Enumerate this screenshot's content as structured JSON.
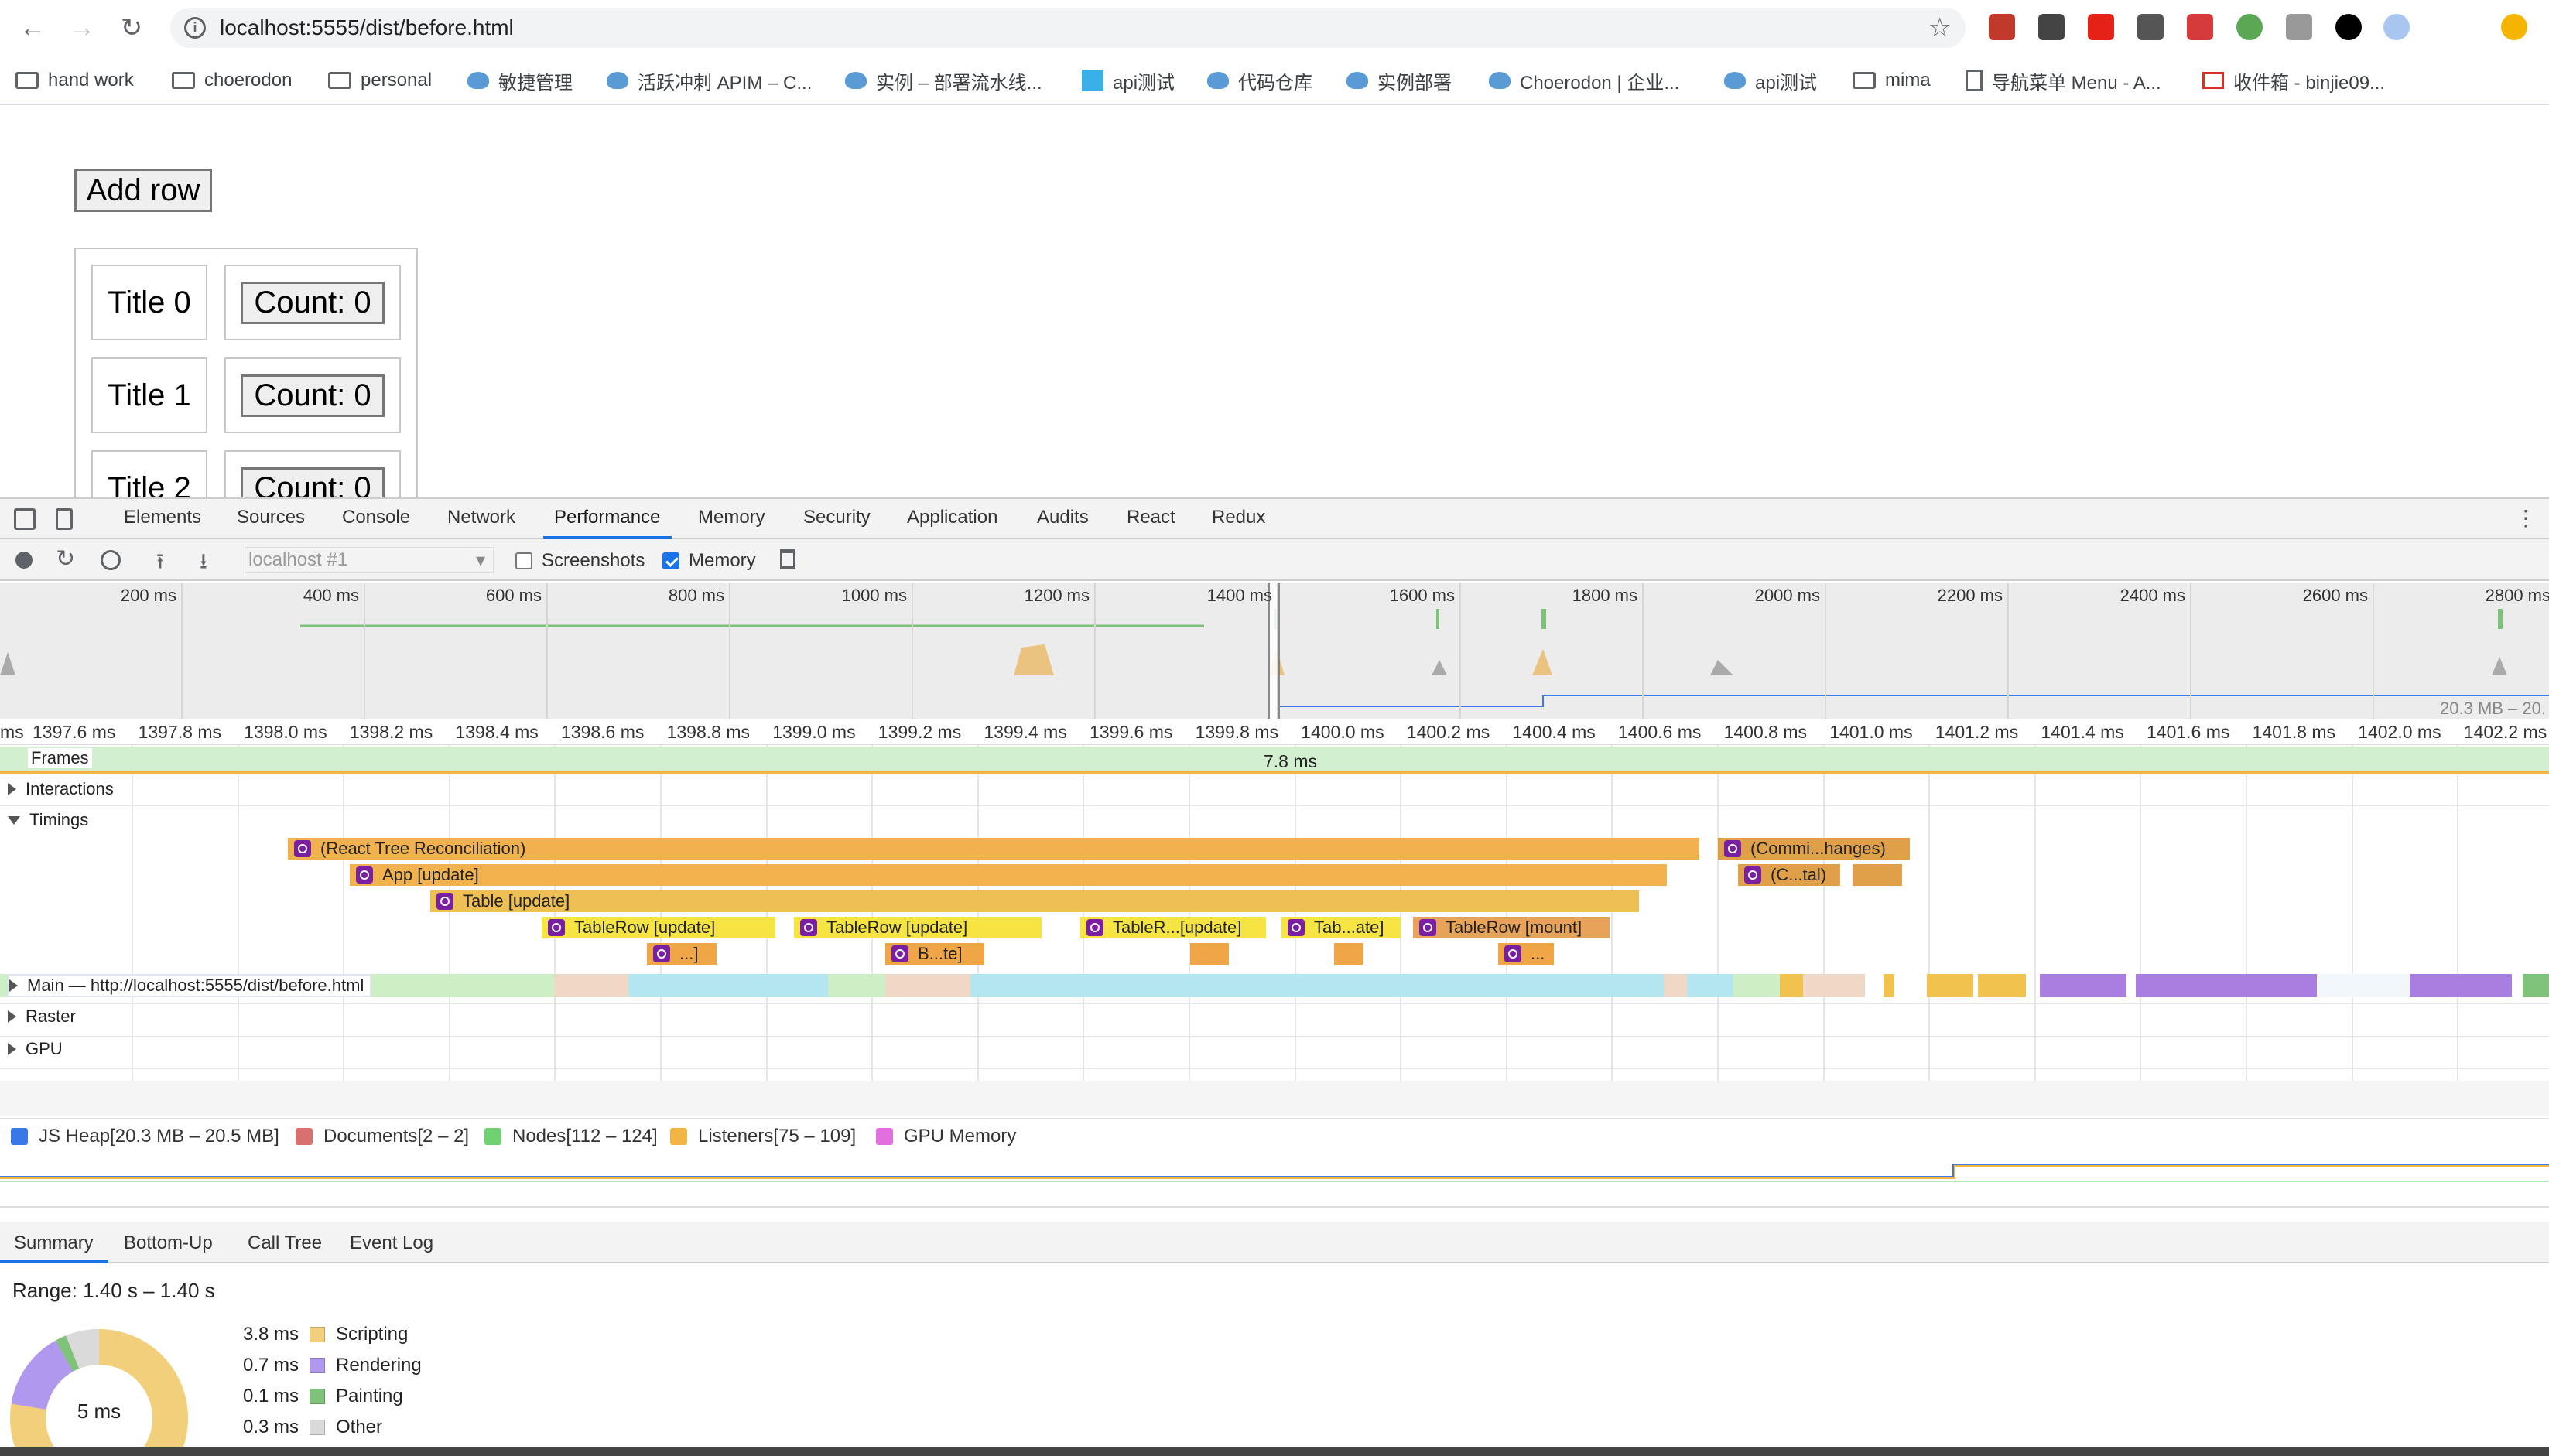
{
  "browser": {
    "url": "localhost:5555/dist/before.html",
    "bookmarks": [
      {
        "label": "hand work",
        "icon": "folder"
      },
      {
        "label": "choerodon",
        "icon": "folder"
      },
      {
        "label": "personal",
        "icon": "folder"
      },
      {
        "label": "敏捷管理",
        "icon": "fav"
      },
      {
        "label": "活跃冲刺 APIM – C...",
        "icon": "fav"
      },
      {
        "label": "实例 – 部署流水线...",
        "icon": "fav"
      },
      {
        "label": "api测试",
        "icon": "square"
      },
      {
        "label": "代码仓库",
        "icon": "fav"
      },
      {
        "label": "实例部署",
        "icon": "fav"
      },
      {
        "label": "Choerodon | 企业...",
        "icon": "fav"
      },
      {
        "label": "api测试",
        "icon": "fav"
      },
      {
        "label": "mima",
        "icon": "folder"
      },
      {
        "label": "导航菜单 Menu - A...",
        "icon": "page"
      },
      {
        "label": "收件箱 - binjie09...",
        "icon": "gmail"
      }
    ]
  },
  "page": {
    "add_row_label": "Add row",
    "rows": [
      {
        "title": "Title 0",
        "count": "Count: 0"
      },
      {
        "title": "Title 1",
        "count": "Count: 0"
      },
      {
        "title": "Title 2",
        "count": "Count: 0"
      }
    ]
  },
  "devtools": {
    "tabs": [
      "Elements",
      "Sources",
      "Console",
      "Network",
      "Performance",
      "Memory",
      "Security",
      "Application",
      "Audits",
      "React",
      "Redux"
    ],
    "active_tab": "Performance",
    "toolbar": {
      "target": "localhost #1",
      "screenshots_label": "Screenshots",
      "screenshots_checked": false,
      "memory_label": "Memory",
      "memory_checked": true
    },
    "overview_ticks": [
      "200 ms",
      "400 ms",
      "600 ms",
      "800 ms",
      "1000 ms",
      "1200 ms",
      "1400 ms",
      "1600 ms",
      "1800 ms",
      "2000 ms",
      "2200 ms",
      "2400 ms",
      "2600 ms",
      "2800 ms"
    ],
    "heap_range_label": "20.3 MB – 20.",
    "ruler_ticks": [
      "ms",
      "1397.6 ms",
      "1397.8 ms",
      "1398.0 ms",
      "1398.2 ms",
      "1398.4 ms",
      "1398.6 ms",
      "1398.8 ms",
      "1399.0 ms",
      "1399.2 ms",
      "1399.4 ms",
      "1399.6 ms",
      "1399.8 ms",
      "1400.0 ms",
      "1400.2 ms",
      "1400.4 ms",
      "1400.6 ms",
      "1400.8 ms",
      "1401.0 ms",
      "1401.2 ms",
      "1401.4 ms",
      "1401.6 ms",
      "1401.8 ms",
      "1402.0 ms",
      "1402.2 ms"
    ],
    "tracks": {
      "frames": "Frames",
      "frame_duration": "7.8 ms",
      "interactions": "Interactions",
      "timings": "Timings",
      "main": "Main — http://localhost:5555/dist/before.html",
      "raster": "Raster",
      "gpu": "GPU"
    },
    "timings": {
      "reconciliation": "(React Tree Reconciliation)",
      "commit": "(Commi...hanges)",
      "app_update": "App [update]",
      "commit_child": "(C...tal)",
      "table_update": "Table [update]",
      "tablerow_1": "TableRow [update]",
      "tablerow_2": "TableRow [update]",
      "tablerow_3": "TableR...[update]",
      "tablerow_4": "Tab...ate]",
      "tablerow_mount": "TableRow [mount]",
      "child_1": "...]",
      "child_2": "B...te]",
      "child_3": "..."
    },
    "memory_legend": [
      {
        "label": "JS Heap[20.3 MB – 20.5 MB]",
        "color": "#3b78e7",
        "checkbox": true,
        "checked": true
      },
      {
        "label": "Documents[2 – 2]",
        "color": "#d97070",
        "checkbox": false
      },
      {
        "label": "Nodes[112 – 124]",
        "color": "#6fd16f",
        "checkbox": false
      },
      {
        "label": "Listeners[75 – 109]",
        "color": "#f2b544",
        "checkbox": true,
        "checked": true
      },
      {
        "label": "GPU Memory",
        "color": "#e26fe0",
        "checkbox": false
      }
    ],
    "summary_tabs": [
      "Summary",
      "Bottom-Up",
      "Call Tree",
      "Event Log"
    ],
    "active_summary_tab": "Summary",
    "range": "Range: 1.40 s – 1.40 s",
    "total": "5 ms",
    "breakdown": [
      {
        "value": "3.8 ms",
        "label": "Scripting",
        "color": "#f2cf7a"
      },
      {
        "value": "0.7 ms",
        "label": "Rendering",
        "color": "#af98ee"
      },
      {
        "value": "0.1 ms",
        "label": "Painting",
        "color": "#7fc27a"
      },
      {
        "value": "0.3 ms",
        "label": "Other",
        "color": "#dadada"
      }
    ]
  }
}
